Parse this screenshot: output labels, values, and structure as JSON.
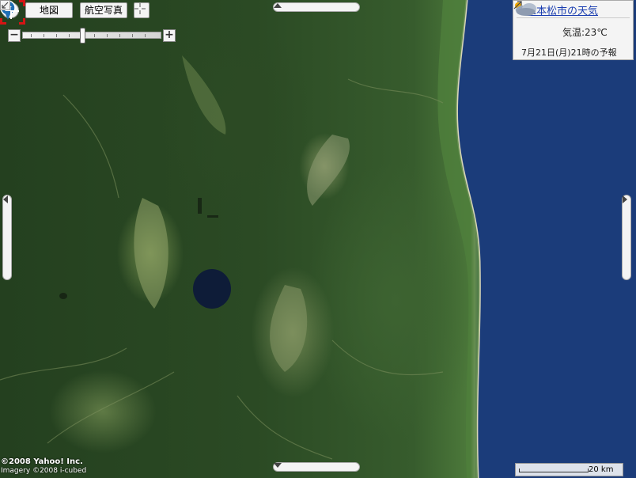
{
  "toolbar": {
    "home_icon": "home-icon",
    "map_label": "地図",
    "aerial_label": "航空写真",
    "crosshair_icon": "crosshair-icon"
  },
  "zoom": {
    "minus_label": "−",
    "plus_label": "+",
    "level_fraction": 0.43
  },
  "weather": {
    "title": "二本松市の天気",
    "temperature": "気温:23℃",
    "forecast": "7月21日(月)21時の予報",
    "icon": "cloud-icon"
  },
  "footer": {
    "copyright": "©2008 Yahoo! Inc.",
    "imagery": "Imagery ©2008 i-cubed",
    "scale_label": "20 km"
  },
  "colors": {
    "land": "#2b4a24",
    "sea": "#1a3a78",
    "coast": "#c9c7a6",
    "link": "#1a3db0",
    "marker": "#1f6fb5",
    "target": "#d41515"
  }
}
